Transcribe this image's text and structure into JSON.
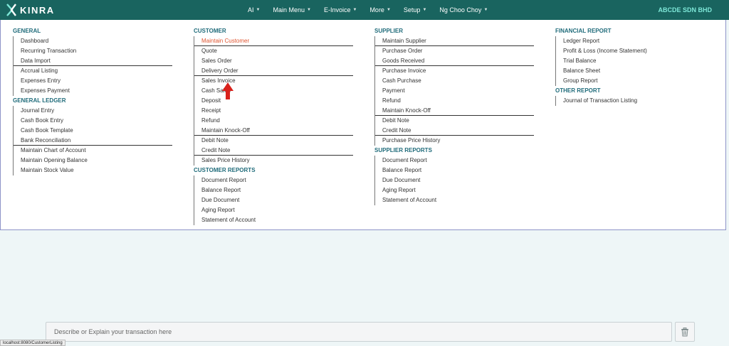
{
  "brand": {
    "name": "KINRA"
  },
  "nav": {
    "items": [
      {
        "label": "AI"
      },
      {
        "label": "Main Menu"
      },
      {
        "label": "E-Invoice"
      },
      {
        "label": "More"
      },
      {
        "label": "Setup"
      },
      {
        "label": "Ng Choo Choy"
      }
    ]
  },
  "company": "ABCDE SDN BHD",
  "menu": {
    "general": {
      "title": "GENERAL",
      "items": [
        "Dashboard",
        "Recurring Transaction",
        "Data Import",
        "Accrual Listing",
        "Expenses Entry",
        "Expenses Payment"
      ]
    },
    "general_ledger": {
      "title": "GENERAL LEDGER",
      "items": [
        "Journal Entry",
        "Cash Book Entry",
        "Cash Book Template",
        "Bank Reconciliation",
        "Maintain Chart of Account",
        "Maintain Opening Balance",
        "Maintain Stock Value"
      ]
    },
    "customer": {
      "title": "CUSTOMER",
      "items": [
        "Maintain Customer",
        "Quote",
        "Sales Order",
        "Delivery Order",
        "Sales Invoice",
        "Cash Sales",
        "Deposit",
        "Receipt",
        "Refund",
        "Maintain Knock-Off",
        "Debit Note",
        "Credit Note",
        "Sales Price History"
      ]
    },
    "customer_reports": {
      "title": "CUSTOMER REPORTS",
      "items": [
        "Document Report",
        "Balance Report",
        "Due Document",
        "Aging Report",
        "Statement of Account"
      ]
    },
    "supplier": {
      "title": "SUPPLIER",
      "items": [
        "Maintain Supplier",
        "Purchase Order",
        "Goods Received",
        "Purchase Invoice",
        "Cash Purchase",
        "Payment",
        "Refund",
        "Maintain Knock-Off",
        "Debit Note",
        "Credit Note",
        "Purchase Price History"
      ]
    },
    "supplier_reports": {
      "title": "SUPPLIER REPORTS",
      "items": [
        "Document Report",
        "Balance Report",
        "Due Document",
        "Aging Report",
        "Statement of Account"
      ]
    },
    "financial_report": {
      "title": "FINANCIAL REPORT",
      "items": [
        "Ledger Report",
        "Profit & Loss (Income Statement)",
        "Trial Balance",
        "Balance Sheet",
        "Group Report"
      ]
    },
    "other_report": {
      "title": "OTHER REPORT",
      "items": [
        "Journal of Transaction Listing"
      ]
    }
  },
  "composer": {
    "placeholder": "Describe or Explain your transaction here"
  },
  "status_url": "localhost:8080/CustomerListing",
  "colors": {
    "topbar": "#19645f",
    "section_title": "#1f6b7a",
    "active_item": "#e05530",
    "company": "#7ee8d8"
  }
}
